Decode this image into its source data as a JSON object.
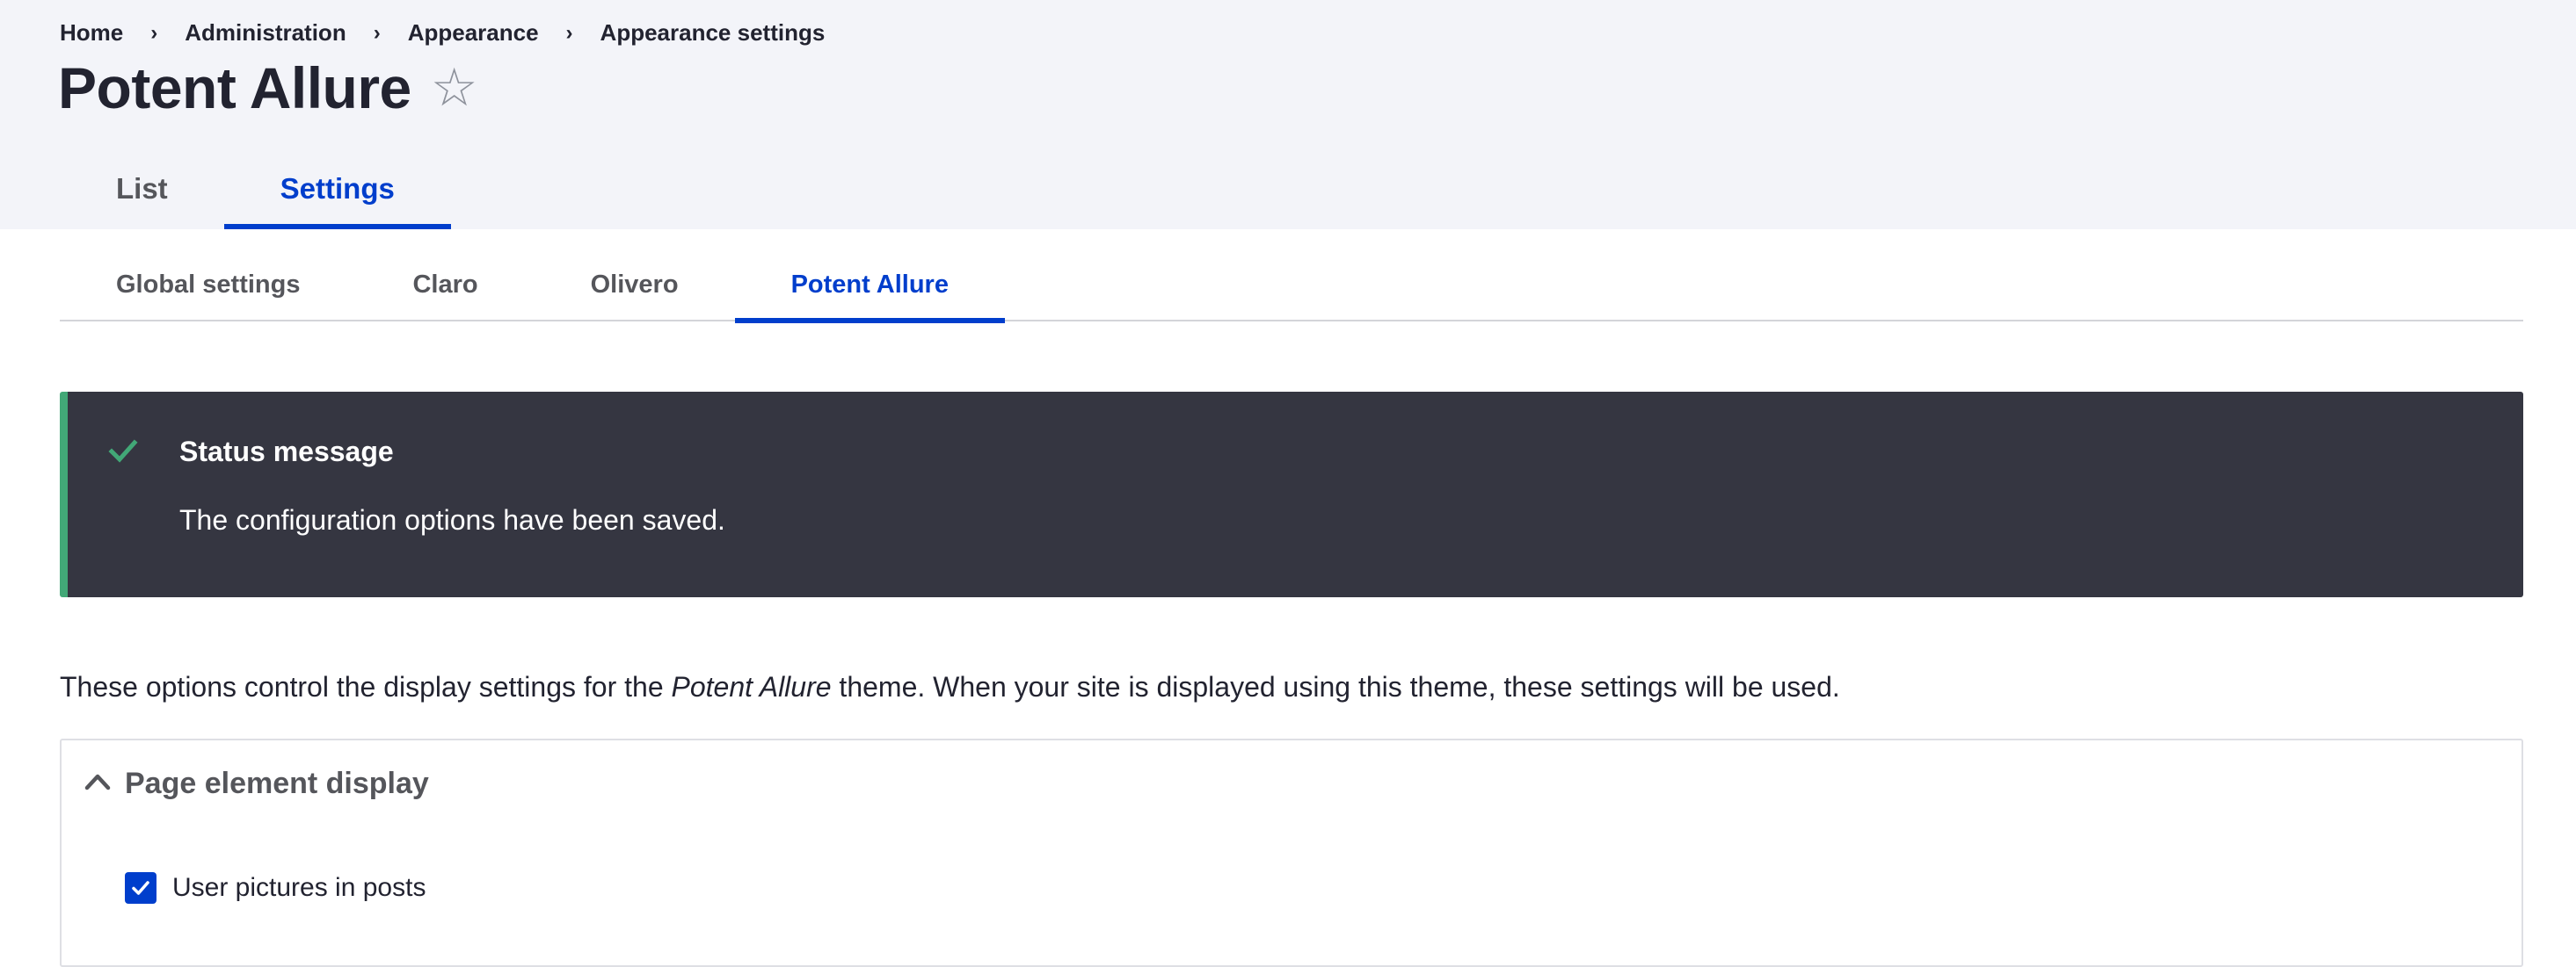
{
  "breadcrumb": {
    "items": [
      "Home",
      "Administration",
      "Appearance",
      "Appearance settings"
    ],
    "separator": "›"
  },
  "page": {
    "title": "Potent Allure",
    "favorite_icon": "☆"
  },
  "primary_tabs": [
    {
      "label": "List",
      "active": false
    },
    {
      "label": "Settings",
      "active": true
    }
  ],
  "secondary_tabs": [
    {
      "label": "Global settings",
      "active": false
    },
    {
      "label": "Claro",
      "active": false
    },
    {
      "label": "Olivero",
      "active": false
    },
    {
      "label": "Potent Allure",
      "active": true
    }
  ],
  "status": {
    "title": "Status message",
    "text": "The configuration options have been saved.",
    "icon": "check-icon",
    "accent_color": "#42a877",
    "background_color": "#353641"
  },
  "intro": {
    "before": "These options control the display settings for the ",
    "theme_name": "Potent Allure",
    "after": " theme. When your site is displayed using this theme, these settings will be used."
  },
  "page_element_display": {
    "summary": "Page element display",
    "expanded": true,
    "options": [
      {
        "label": "User pictures in posts",
        "checked": true
      }
    ]
  },
  "colors": {
    "accent": "#003ecc",
    "header_bg": "#f3f4f9",
    "text": "#222330",
    "muted_text": "#55565b"
  }
}
